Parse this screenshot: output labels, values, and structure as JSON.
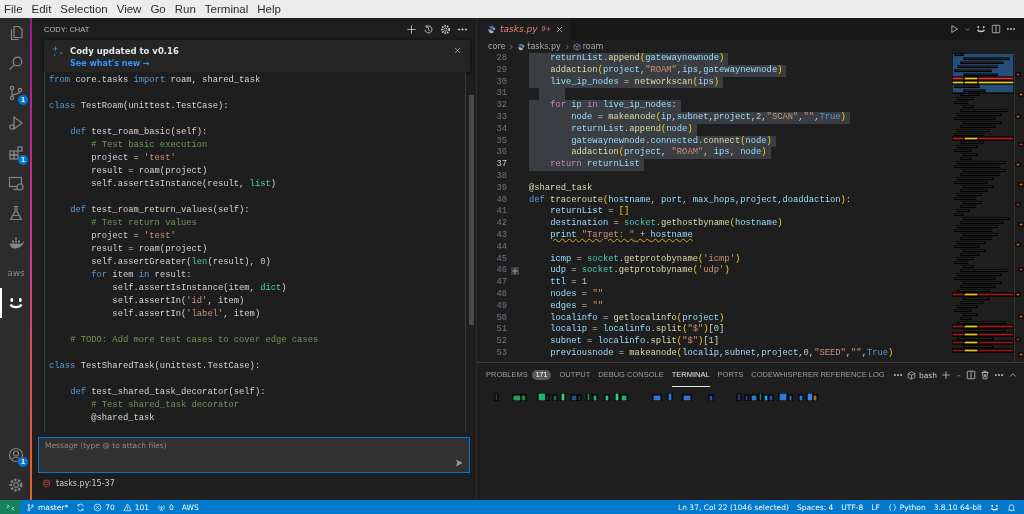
{
  "menu_bar": {
    "items": [
      "File",
      "Edit",
      "Selection",
      "View",
      "Go",
      "Run",
      "Terminal",
      "Help"
    ]
  },
  "activity_bar": {
    "items": [
      {
        "kind": "files",
        "selected": false
      },
      {
        "kind": "search",
        "selected": false
      },
      {
        "kind": "source-control",
        "selected": false,
        "badge": "1"
      },
      {
        "kind": "run",
        "selected": false
      },
      {
        "kind": "extensions",
        "selected": false,
        "badge": "1"
      },
      {
        "kind": "remote",
        "selected": false
      },
      {
        "kind": "testing",
        "selected": false
      },
      {
        "kind": "docker",
        "selected": false
      },
      {
        "kind": "aws",
        "selected": false,
        "label": "aws"
      },
      {
        "kind": "cody",
        "selected": true
      }
    ],
    "bottom": [
      {
        "kind": "account",
        "badge": "1"
      },
      {
        "kind": "settings"
      }
    ]
  },
  "chat": {
    "title": "CODY: CHAT",
    "notification": {
      "title": "Cody updated to v0.16",
      "link": "See what's new →"
    },
    "code": [
      {
        "kind": "code",
        "segments": [
          {
            "kind": "kw",
            "text": "from"
          },
          {
            "kind": "p",
            "text": " core.tasks "
          },
          {
            "kind": "kw",
            "text": "import"
          },
          {
            "kind": "p",
            "text": " roam, shared_task"
          }
        ]
      },
      {
        "kind": "blank"
      },
      {
        "kind": "code",
        "segments": [
          {
            "kind": "kw",
            "text": "class"
          },
          {
            "kind": "p",
            "text": " TestRoam(unittest.TestCase):"
          }
        ]
      },
      {
        "kind": "blank"
      },
      {
        "kind": "code",
        "segments": [
          {
            "kind": "kw",
            "text": "    def"
          },
          {
            "kind": "p",
            "text": " test_roam_basic(self):"
          }
        ]
      },
      {
        "kind": "code",
        "segments": [
          {
            "kind": "cm",
            "text": "        # Test basic execution"
          }
        ]
      },
      {
        "kind": "code",
        "segments": [
          {
            "kind": "p",
            "text": "        project = "
          },
          {
            "kind": "str",
            "text": "'test'"
          }
        ]
      },
      {
        "kind": "code",
        "segments": [
          {
            "kind": "p",
            "text": "        result = roam(project)"
          }
        ]
      },
      {
        "kind": "code",
        "segments": [
          {
            "kind": "p",
            "text": "        self.assertIsInstance(result, "
          },
          {
            "kind": "type",
            "text": "list"
          },
          {
            "kind": "p",
            "text": ")"
          }
        ]
      },
      {
        "kind": "blank"
      },
      {
        "kind": "code",
        "segments": [
          {
            "kind": "kw",
            "text": "    def"
          },
          {
            "kind": "p",
            "text": " test_roam_return_values(self):"
          }
        ]
      },
      {
        "kind": "code",
        "segments": [
          {
            "kind": "cm",
            "text": "        # Test return values"
          }
        ]
      },
      {
        "kind": "code",
        "segments": [
          {
            "kind": "p",
            "text": "        project = "
          },
          {
            "kind": "str",
            "text": "'test'"
          }
        ]
      },
      {
        "kind": "code",
        "segments": [
          {
            "kind": "p",
            "text": "        result = roam(project)"
          }
        ]
      },
      {
        "kind": "code",
        "segments": [
          {
            "kind": "p",
            "text": "        self.assertGreater("
          },
          {
            "kind": "type",
            "text": "len"
          },
          {
            "kind": "p",
            "text": "(result), "
          },
          {
            "kind": "num",
            "text": "0"
          },
          {
            "kind": "p",
            "text": ")"
          }
        ]
      },
      {
        "kind": "code",
        "segments": [
          {
            "kind": "kw",
            "text": "        for"
          },
          {
            "kind": "p",
            "text": " item "
          },
          {
            "kind": "kw",
            "text": "in"
          },
          {
            "kind": "p",
            "text": " result:"
          }
        ]
      },
      {
        "kind": "code",
        "segments": [
          {
            "kind": "p",
            "text": "            self.assertIsInstance(item, "
          },
          {
            "kind": "type",
            "text": "dict"
          },
          {
            "kind": "p",
            "text": ")"
          }
        ]
      },
      {
        "kind": "code",
        "segments": [
          {
            "kind": "p",
            "text": "            self.assertIn("
          },
          {
            "kind": "str",
            "text": "'id'"
          },
          {
            "kind": "p",
            "text": ", item)"
          }
        ]
      },
      {
        "kind": "code",
        "segments": [
          {
            "kind": "p",
            "text": "            self.assertIn("
          },
          {
            "kind": "str",
            "text": "'label'"
          },
          {
            "kind": "p",
            "text": ", item)"
          }
        ]
      },
      {
        "kind": "blank"
      },
      {
        "kind": "code",
        "segments": [
          {
            "kind": "cm",
            "text": "    # TODO: Add more test cases to cover edge cases"
          }
        ]
      },
      {
        "kind": "blank"
      },
      {
        "kind": "code",
        "segments": [
          {
            "kind": "kw",
            "text": "class"
          },
          {
            "kind": "p",
            "text": " TestSharedTask(unittest.TestCase):"
          }
        ]
      },
      {
        "kind": "blank"
      },
      {
        "kind": "code",
        "segments": [
          {
            "kind": "kw",
            "text": "    def"
          },
          {
            "kind": "p",
            "text": " test_shared_task_decorator(self):"
          }
        ]
      },
      {
        "kind": "code",
        "segments": [
          {
            "kind": "cm",
            "text": "        # Test shared_task decorator"
          }
        ]
      },
      {
        "kind": "code",
        "segments": [
          {
            "kind": "p",
            "text": "        @shared_task"
          }
        ]
      }
    ],
    "input": {
      "placeholder": "Message (type @ to attach files)"
    },
    "context_file": "tasks.py:15-37"
  },
  "editor": {
    "tab": {
      "label": "tasks.py",
      "problems": "9+"
    },
    "breadcrumbs": [
      {
        "kind": "folder",
        "label": "core"
      },
      {
        "kind": "file",
        "label": "tasks.py"
      },
      {
        "kind": "symbol",
        "label": "roam"
      }
    ],
    "lines": [
      {
        "number": "28",
        "kind": "code",
        "selected": true,
        "current": false,
        "segments": [
          {
            "kind": "var",
            "text": "    returnList"
          },
          {
            "kind": "p",
            "text": "."
          },
          {
            "kind": "fn",
            "text": "append"
          },
          {
            "kind": "br",
            "text": "("
          },
          {
            "kind": "var",
            "text": "gatewaynewnode"
          },
          {
            "kind": "br",
            "text": ")"
          }
        ]
      },
      {
        "number": "29",
        "kind": "code",
        "selected": true,
        "current": false,
        "segments": [
          {
            "kind": "fn",
            "text": "    addaction"
          },
          {
            "kind": "br",
            "text": "("
          },
          {
            "kind": "var",
            "text": "project"
          },
          {
            "kind": "p",
            "text": ","
          },
          {
            "kind": "str",
            "text": "\"ROAM\""
          },
          {
            "kind": "p",
            "text": ","
          },
          {
            "kind": "var",
            "text": "ips"
          },
          {
            "kind": "p",
            "text": ","
          },
          {
            "kind": "var",
            "text": "gatewaynewnode"
          },
          {
            "kind": "br",
            "text": ")"
          }
        ]
      },
      {
        "number": "30",
        "kind": "code",
        "selected": true,
        "current": false,
        "segments": [
          {
            "kind": "var",
            "text": "    live_ip_nodes"
          },
          {
            "kind": "p",
            "text": " = "
          },
          {
            "kind": "fn",
            "text": "networkscan"
          },
          {
            "kind": "br",
            "text": "("
          },
          {
            "kind": "var",
            "text": "ips"
          },
          {
            "kind": "br",
            "text": ")"
          }
        ]
      },
      {
        "number": "31",
        "kind": "code",
        "selected": true,
        "current": false
      },
      {
        "number": "32",
        "kind": "code",
        "selected": true,
        "current": false,
        "segments": [
          {
            "kind": "ctrl",
            "text": "    for"
          },
          {
            "kind": "var",
            "text": " ip "
          },
          {
            "kind": "ctrl",
            "text": "in"
          },
          {
            "kind": "var",
            "text": " live_ip_nodes"
          },
          {
            "kind": "p",
            "text": ":"
          }
        ]
      },
      {
        "number": "33",
        "kind": "code",
        "selected": true,
        "current": false,
        "segments": [
          {
            "kind": "var",
            "text": "        node"
          },
          {
            "kind": "p",
            "text": " = "
          },
          {
            "kind": "fn",
            "text": "makeanode"
          },
          {
            "kind": "br",
            "text": "("
          },
          {
            "kind": "var",
            "text": "ip"
          },
          {
            "kind": "p",
            "text": ","
          },
          {
            "kind": "var",
            "text": "subnet"
          },
          {
            "kind": "p",
            "text": ","
          },
          {
            "kind": "var",
            "text": "project"
          },
          {
            "kind": "p",
            "text": ","
          },
          {
            "kind": "num",
            "text": "2"
          },
          {
            "kind": "p",
            "text": ","
          },
          {
            "kind": "str",
            "text": "\"SCAN\""
          },
          {
            "kind": "p",
            "text": ","
          },
          {
            "kind": "str",
            "text": "\"\""
          },
          {
            "kind": "p",
            "text": ","
          },
          {
            "kind": "kw",
            "text": "True"
          },
          {
            "kind": "br",
            "text": ")"
          }
        ]
      },
      {
        "number": "34",
        "kind": "code",
        "selected": true,
        "current": false,
        "segments": [
          {
            "kind": "var",
            "text": "        returnList"
          },
          {
            "kind": "p",
            "text": "."
          },
          {
            "kind": "fn",
            "text": "append"
          },
          {
            "kind": "br",
            "text": "("
          },
          {
            "kind": "var",
            "text": "node"
          },
          {
            "kind": "br",
            "text": ")"
          }
        ]
      },
      {
        "number": "35",
        "kind": "code",
        "selected": true,
        "current": false,
        "segments": [
          {
            "kind": "var",
            "text": "        gatewaynewnode"
          },
          {
            "kind": "p",
            "text": "."
          },
          {
            "kind": "var",
            "text": "connected"
          },
          {
            "kind": "p",
            "text": "."
          },
          {
            "kind": "fn",
            "text": "connect"
          },
          {
            "kind": "br",
            "text": "("
          },
          {
            "kind": "var",
            "text": "node"
          },
          {
            "kind": "br",
            "text": ")"
          }
        ]
      },
      {
        "number": "36",
        "kind": "code",
        "selected": true,
        "current": false,
        "segments": [
          {
            "kind": "fn",
            "text": "        addaction"
          },
          {
            "kind": "br",
            "text": "("
          },
          {
            "kind": "var",
            "text": "project"
          },
          {
            "kind": "p",
            "text": ", "
          },
          {
            "kind": "str",
            "text": "\"ROAM\""
          },
          {
            "kind": "p",
            "text": ", "
          },
          {
            "kind": "var",
            "text": "ips"
          },
          {
            "kind": "p",
            "text": ", "
          },
          {
            "kind": "var",
            "text": "node"
          },
          {
            "kind": "br",
            "text": ")"
          }
        ]
      },
      {
        "number": "37",
        "kind": "code",
        "selected": true,
        "current": true,
        "segments": [
          {
            "kind": "ctrl",
            "text": "    return"
          },
          {
            "kind": "var",
            "text": " returnList"
          }
        ]
      },
      {
        "number": "38",
        "kind": "code",
        "selected": false,
        "current": false
      },
      {
        "number": "39",
        "kind": "code",
        "selected": false,
        "current": false,
        "segments": [
          {
            "kind": "fn",
            "text": "@shared_task"
          }
        ]
      },
      {
        "number": "40",
        "kind": "code",
        "selected": false,
        "current": false,
        "segments": [
          {
            "kind": "kw",
            "text": "def"
          },
          {
            "kind": "fn",
            "text": " traceroute"
          },
          {
            "kind": "br",
            "text": "("
          },
          {
            "kind": "var",
            "text": "hostname"
          },
          {
            "kind": "p",
            "text": ", "
          },
          {
            "kind": "var",
            "text": "port"
          },
          {
            "kind": "p",
            "text": ", "
          },
          {
            "kind": "var",
            "text": "max_hops"
          },
          {
            "kind": "p",
            "text": ","
          },
          {
            "kind": "var",
            "text": "project"
          },
          {
            "kind": "p",
            "text": ","
          },
          {
            "kind": "var",
            "text": "doaddaction"
          },
          {
            "kind": "br",
            "text": ")"
          },
          {
            "kind": "p",
            "text": ":"
          }
        ]
      },
      {
        "number": "41",
        "kind": "code",
        "selected": false,
        "current": false,
        "segments": [
          {
            "kind": "var",
            "text": "    returnList"
          },
          {
            "kind": "p",
            "text": " = "
          },
          {
            "kind": "br",
            "text": "[]"
          }
        ]
      },
      {
        "number": "42",
        "kind": "code",
        "selected": false,
        "current": false,
        "segments": [
          {
            "kind": "var",
            "text": "    destination"
          },
          {
            "kind": "p",
            "text": " = "
          },
          {
            "kind": "type",
            "text": "socket"
          },
          {
            "kind": "p",
            "text": "."
          },
          {
            "kind": "fn",
            "text": "gethostbyname"
          },
          {
            "kind": "br",
            "text": "("
          },
          {
            "kind": "var",
            "text": "hostname"
          },
          {
            "kind": "br",
            "text": ")"
          }
        ]
      },
      {
        "number": "43",
        "kind": "warning",
        "selected": false,
        "current": false,
        "segments": [
          {
            "kind": "var",
            "text": "    print"
          },
          {
            "kind": "str",
            "text": " \"Target: \""
          },
          {
            "kind": "p",
            "text": " + "
          },
          {
            "kind": "var",
            "text": "hostname"
          }
        ]
      },
      {
        "number": "44",
        "kind": "code",
        "selected": false,
        "current": false
      },
      {
        "number": "45",
        "kind": "code",
        "selected": false,
        "current": false,
        "segments": [
          {
            "kind": "var",
            "text": "    icmp"
          },
          {
            "kind": "p",
            "text": " = "
          },
          {
            "kind": "type",
            "text": "socket"
          },
          {
            "kind": "p",
            "text": "."
          },
          {
            "kind": "fn",
            "text": "getprotobyname"
          },
          {
            "kind": "br",
            "text": "("
          },
          {
            "kind": "str",
            "text": "'icmp'"
          },
          {
            "kind": "br",
            "text": ")"
          }
        ]
      },
      {
        "number": "46",
        "kind": "hover",
        "selected": false,
        "current": false,
        "segments": [
          {
            "kind": "var",
            "text": "    udp"
          },
          {
            "kind": "p",
            "text": " = "
          },
          {
            "kind": "type",
            "text": "socket"
          },
          {
            "kind": "p",
            "text": "."
          },
          {
            "kind": "fn",
            "text": "getprotobyname"
          },
          {
            "kind": "br",
            "text": "("
          },
          {
            "kind": "str",
            "text": "'udp'"
          },
          {
            "kind": "br",
            "text": ")"
          }
        ]
      },
      {
        "number": "47",
        "kind": "code",
        "selected": false,
        "current": false,
        "segments": [
          {
            "kind": "var",
            "text": "    ttl"
          },
          {
            "kind": "p",
            "text": " = "
          },
          {
            "kind": "num",
            "text": "1"
          }
        ]
      },
      {
        "number": "48",
        "kind": "code",
        "selected": false,
        "current": false,
        "segments": [
          {
            "kind": "var",
            "text": "    nodes"
          },
          {
            "kind": "p",
            "text": " = "
          },
          {
            "kind": "str",
            "text": "\"\""
          }
        ]
      },
      {
        "number": "49",
        "kind": "code",
        "selected": false,
        "current": false,
        "segments": [
          {
            "kind": "var",
            "text": "    edges"
          },
          {
            "kind": "p",
            "text": " = "
          },
          {
            "kind": "str",
            "text": "\"\""
          }
        ]
      },
      {
        "number": "50",
        "kind": "code",
        "selected": false,
        "current": false,
        "segments": [
          {
            "kind": "var",
            "text": "    localinfo"
          },
          {
            "kind": "p",
            "text": " = "
          },
          {
            "kind": "fn",
            "text": "getlocalinfo"
          },
          {
            "kind": "br",
            "text": "("
          },
          {
            "kind": "var",
            "text": "project"
          },
          {
            "kind": "br",
            "text": ")"
          }
        ]
      },
      {
        "number": "51",
        "kind": "code",
        "selected": false,
        "current": false,
        "segments": [
          {
            "kind": "var",
            "text": "    localip"
          },
          {
            "kind": "p",
            "text": " = "
          },
          {
            "kind": "var",
            "text": "localinfo"
          },
          {
            "kind": "p",
            "text": "."
          },
          {
            "kind": "fn",
            "text": "split"
          },
          {
            "kind": "br",
            "text": "("
          },
          {
            "kind": "str",
            "text": "\"$\""
          },
          {
            "kind": "br",
            "text": ")"
          },
          {
            "kind": "p",
            "text": "["
          },
          {
            "kind": "num",
            "text": "0"
          },
          {
            "kind": "p",
            "text": "]"
          }
        ]
      },
      {
        "number": "52",
        "kind": "code",
        "selected": false,
        "current": false,
        "segments": [
          {
            "kind": "var",
            "text": "    subnet"
          },
          {
            "kind": "p",
            "text": " = "
          },
          {
            "kind": "var",
            "text": "localinfo"
          },
          {
            "kind": "p",
            "text": "."
          },
          {
            "kind": "fn",
            "text": "split"
          },
          {
            "kind": "br",
            "text": "("
          },
          {
            "kind": "str",
            "text": "\"$\""
          },
          {
            "kind": "br",
            "text": ")"
          },
          {
            "kind": "p",
            "text": "["
          },
          {
            "kind": "num",
            "text": "1"
          },
          {
            "kind": "p",
            "text": "]"
          }
        ]
      },
      {
        "number": "53",
        "kind": "code",
        "selected": false,
        "current": false,
        "segments": [
          {
            "kind": "var",
            "text": "    previousnode"
          },
          {
            "kind": "p",
            "text": " = "
          },
          {
            "kind": "fn",
            "text": "makeanode"
          },
          {
            "kind": "br",
            "text": "("
          },
          {
            "kind": "var",
            "text": "localip"
          },
          {
            "kind": "p",
            "text": ","
          },
          {
            "kind": "var",
            "text": "subnet"
          },
          {
            "kind": "p",
            "text": ","
          },
          {
            "kind": "var",
            "text": "project"
          },
          {
            "kind": "p",
            "text": ","
          },
          {
            "kind": "num",
            "text": "0"
          },
          {
            "kind": "p",
            "text": ","
          },
          {
            "kind": "str",
            "text": "\"SEED\""
          },
          {
            "kind": "p",
            "text": ","
          },
          {
            "kind": "str",
            "text": "\"\""
          },
          {
            "kind": "p",
            "text": ","
          },
          {
            "kind": "kw",
            "text": "True"
          },
          {
            "kind": "br",
            "text": ")"
          }
        ]
      }
    ]
  },
  "panel": {
    "tabs": [
      {
        "label": "PROBLEMS",
        "badge": "171",
        "selected": false
      },
      {
        "label": "OUTPUT",
        "selected": false
      },
      {
        "label": "DEBUG CONSOLE",
        "selected": false
      },
      {
        "label": "TERMINAL",
        "selected": true
      },
      {
        "label": "PORTS",
        "selected": false
      },
      {
        "label": "CODEWHISPERER REFERENCE LOG",
        "selected": false
      }
    ],
    "shell": "bash"
  },
  "status_bar": {
    "left": [
      {
        "kind": "remote"
      },
      {
        "kind": "branch",
        "text": "master*"
      },
      {
        "kind": "sync"
      },
      {
        "kind": "errors",
        "text": "70"
      },
      {
        "kind": "warnings",
        "text": "101"
      },
      {
        "kind": "ports",
        "text": "0"
      },
      {
        "kind": "text",
        "text": "AWS"
      }
    ],
    "right": [
      {
        "kind": "text",
        "text": "Ln 37, Col 22 (1046 selected)"
      },
      {
        "kind": "text",
        "text": "Spaces: 4"
      },
      {
        "kind": "text",
        "text": "UTF-8"
      },
      {
        "kind": "text",
        "text": "LF"
      },
      {
        "kind": "language",
        "text": "Python"
      },
      {
        "kind": "text",
        "text": "3.8.10 64-bit"
      },
      {
        "kind": "cody"
      },
      {
        "kind": "bell"
      }
    ]
  }
}
